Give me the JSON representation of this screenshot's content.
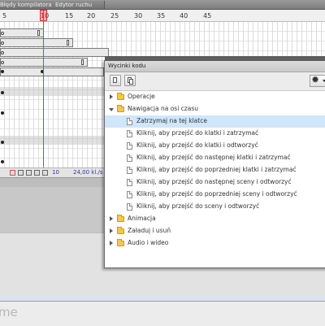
{
  "tabs": [
    {
      "label": "Błędy kompilatora"
    },
    {
      "label": "Edytor ruchu"
    }
  ],
  "timeline": {
    "ruler_numbers": [
      "5",
      "10",
      "15",
      "20",
      "25",
      "30",
      "35",
      "40",
      "45"
    ],
    "fps": "24,00 kl./s",
    "current_frame": "10"
  },
  "panel": {
    "title": "Wycinki kodu",
    "tree": [
      {
        "type": "folder",
        "label": "Operacje",
        "expanded": false
      },
      {
        "type": "folder",
        "label": "Nawigacja na osi czasu",
        "expanded": true
      },
      {
        "type": "snippet",
        "label": "Zatrzymaj na tej klatce",
        "selected": true
      },
      {
        "type": "snippet",
        "label": "Kliknij, aby przejść do klatki i zatrzymać"
      },
      {
        "type": "snippet",
        "label": "Kliknij, aby przejść do klatki i odtworzyć"
      },
      {
        "type": "snippet",
        "label": "Kliknij, aby przejść do następnej klatki i zatrzymać"
      },
      {
        "type": "snippet",
        "label": "Kliknij, aby przejść do poprzedniej klatki i zatrzymać"
      },
      {
        "type": "snippet",
        "label": "Kliknij, aby przejść do następnej sceny i odtworzyć"
      },
      {
        "type": "snippet",
        "label": "Kliknij, aby przejść do poprzedniej sceny i odtworzyć"
      },
      {
        "type": "snippet",
        "label": "Kliknij, aby przejść do sceny i odtworzyć"
      },
      {
        "type": "folder",
        "label": "Animacja",
        "expanded": false
      },
      {
        "type": "folder",
        "label": "Załaduj i usuń",
        "expanded": false
      },
      {
        "type": "folder",
        "label": "Audio i wideo",
        "expanded": false
      }
    ]
  },
  "bottom": {
    "placeholder_fragment": "me"
  },
  "colors": {
    "playhead": "#e33333",
    "selection": "#cfe6fb",
    "folder": "#f1c94d"
  }
}
